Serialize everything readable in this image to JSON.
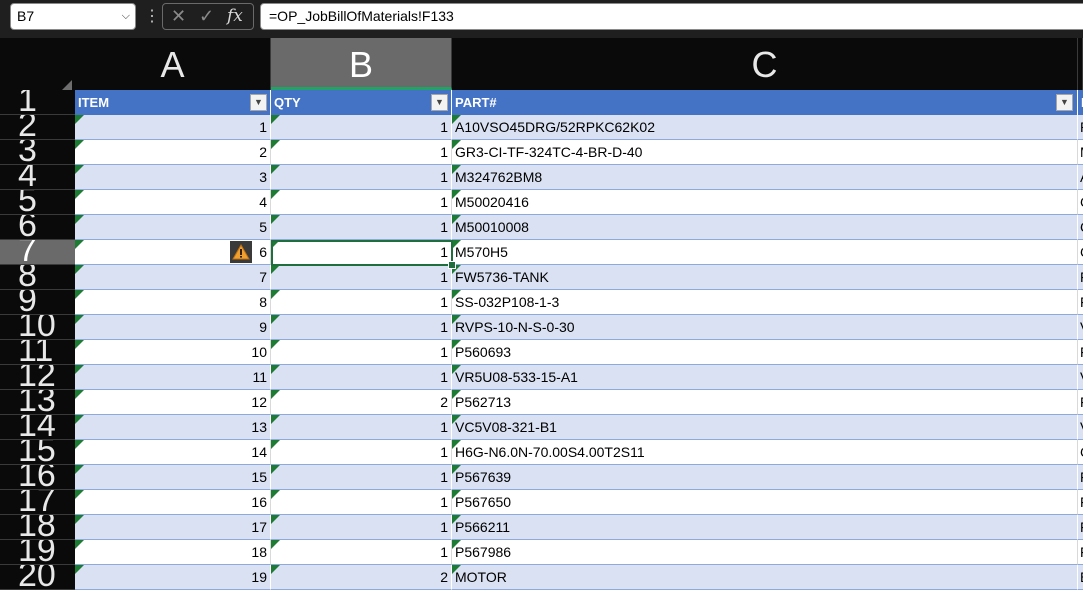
{
  "namebox": {
    "value": "B7"
  },
  "formula_bar": {
    "value": "=OP_JobBillOfMaterials!F133",
    "fx_label": "fx"
  },
  "columns": [
    {
      "letter": "A"
    },
    {
      "letter": "B"
    },
    {
      "letter": "C"
    }
  ],
  "row_numbers": [
    "1",
    "2",
    "3",
    "4",
    "5",
    "6",
    "7",
    "8",
    "9",
    "10",
    "11",
    "12",
    "13",
    "14",
    "15",
    "16",
    "17",
    "18",
    "19",
    "20"
  ],
  "table": {
    "headers": {
      "item": "ITEM",
      "qty": "QTY",
      "part": "PART#",
      "next": "D"
    },
    "rows": [
      {
        "item": "1",
        "qty": "1",
        "part": "A10VSO45DRG/52RPKC62K02",
        "next": "P"
      },
      {
        "item": "2",
        "qty": "1",
        "part": "GR3-CI-TF-324TC-4-BR-D-40",
        "next": "M"
      },
      {
        "item": "3",
        "qty": "1",
        "part": "M324762BM8",
        "next": "A"
      },
      {
        "item": "4",
        "qty": "1",
        "part": "M50020416",
        "next": "C"
      },
      {
        "item": "5",
        "qty": "1",
        "part": "M50010008",
        "next": "C"
      },
      {
        "item": "6",
        "qty": "1",
        "part": "M570H5",
        "next": "C"
      },
      {
        "item": "7",
        "qty": "1",
        "part": "FW5736-TANK",
        "next": "F"
      },
      {
        "item": "8",
        "qty": "1",
        "part": "SS-032P108-1-3",
        "next": "F"
      },
      {
        "item": "9",
        "qty": "1",
        "part": "RVPS-10-N-S-0-30",
        "next": "V"
      },
      {
        "item": "10",
        "qty": "1",
        "part": "P560693",
        "next": "F"
      },
      {
        "item": "11",
        "qty": "1",
        "part": "VR5U08-533-15-A1",
        "next": "V"
      },
      {
        "item": "12",
        "qty": "2",
        "part": "P562713",
        "next": "F"
      },
      {
        "item": "13",
        "qty": "1",
        "part": "VC5V08-321-B1",
        "next": "V"
      },
      {
        "item": "14",
        "qty": "1",
        "part": "H6G-N6.0N-70.00S4.00T2S11",
        "next": "C"
      },
      {
        "item": "15",
        "qty": "1",
        "part": "P567639",
        "next": "F"
      },
      {
        "item": "16",
        "qty": "1",
        "part": "P567650",
        "next": "F"
      },
      {
        "item": "17",
        "qty": "1",
        "part": "P566211",
        "next": "F"
      },
      {
        "item": "18",
        "qty": "1",
        "part": "P567986",
        "next": "F"
      },
      {
        "item": "19",
        "qty": "2",
        "part": "MOTOR",
        "next": "E"
      }
    ]
  },
  "colors": {
    "header_blue": "#4472c4",
    "band": "#d9e1f2",
    "selection_green": "#1e6e3e"
  }
}
